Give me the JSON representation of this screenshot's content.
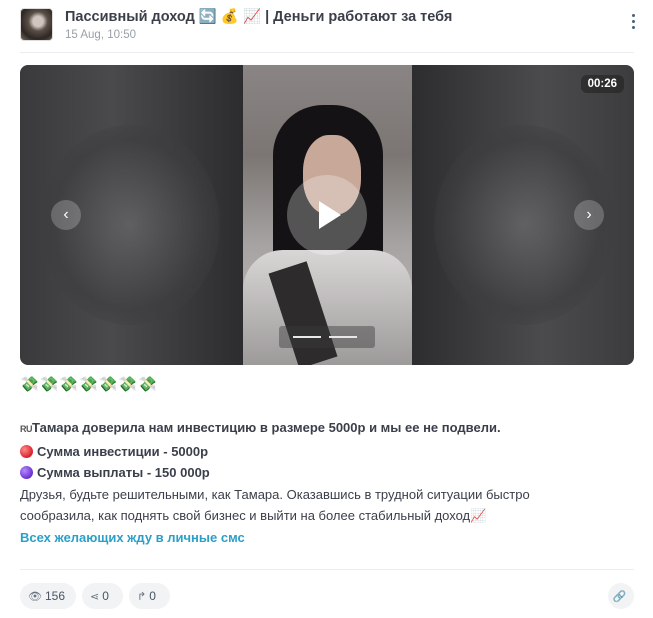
{
  "header": {
    "channel_title": "Пассивный доход 🔄 💰 📈 | Деньги работают за тебя",
    "date": "15 Aug, 10:50"
  },
  "video": {
    "duration": "00:26"
  },
  "post": {
    "emoji_row": "💸💸💸💸💸💸💸",
    "flag": "RU",
    "line1": "Тамара доверила нам инвестицию в размере 5000р и мы ее не подвели.",
    "line2": "Сумма инвестиции - 5000р",
    "line3": "Сумма выплаты - 150 000р",
    "line4": "Друзья, будьте решительными, как Тамара. Оказавшись в трудной ситуации быстро",
    "line5": "сообразила, как поднять свой бизнес и выйти на более стабильный доход📈",
    "link": "Всех желающих жду в личные смс"
  },
  "footer": {
    "views": "156",
    "shares": "0",
    "forwards": "0"
  },
  "icons": {
    "views": "eye-icon",
    "shares": "share-icon",
    "forwards": "forward-icon",
    "link": "link-icon",
    "menu": "kebab-menu-icon"
  }
}
